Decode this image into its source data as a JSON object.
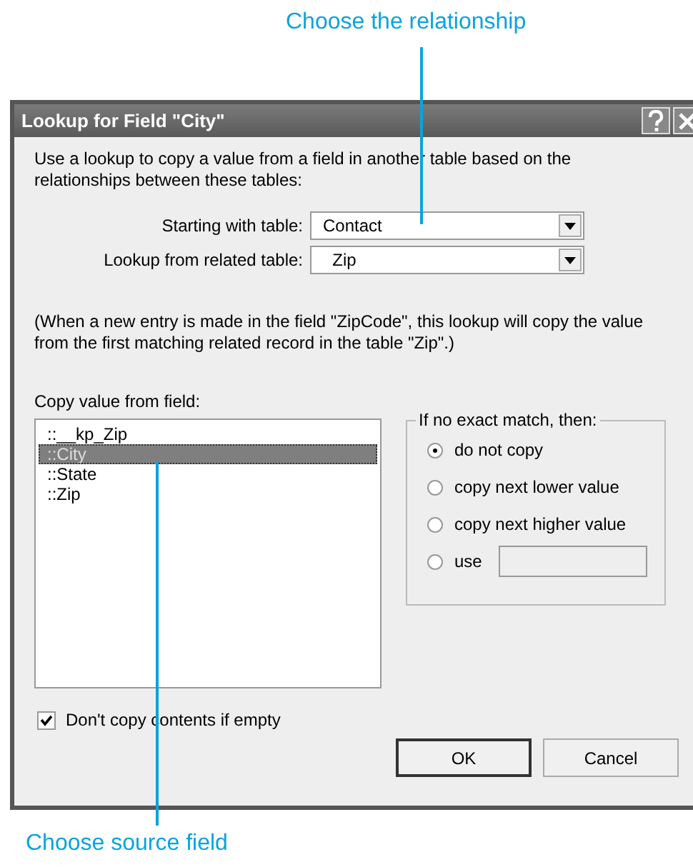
{
  "callouts": [
    {
      "text": "Choose the relationship"
    },
    {
      "text": "Choose source field"
    }
  ],
  "window": {
    "title": "Lookup for Field \"City\""
  },
  "intro": "Use a lookup to copy a value from a field in another table based on the relationships between these tables:",
  "selects": [
    {
      "label": "Starting with table:",
      "value": "Contact"
    },
    {
      "label": "Lookup from related table:",
      "value": "  Zip"
    }
  ],
  "note": "(When a new entry is made in the field \"ZipCode\", this lookup will copy the value from the first matching related record in the table \"Zip\".)",
  "copy_label": "Copy value from field:",
  "fields": [
    {
      "label": "::__kp_Zip",
      "selected": false
    },
    {
      "label": "::City",
      "selected": true
    },
    {
      "label": "::State",
      "selected": false
    },
    {
      "label": "::Zip",
      "selected": false
    }
  ],
  "group": {
    "title": "If no exact match, then:",
    "options": [
      {
        "label": "do not copy",
        "selected": true,
        "kind": "radio"
      },
      {
        "label": "copy next lower value",
        "selected": false,
        "kind": "radio"
      },
      {
        "label": "copy next higher value",
        "selected": false,
        "kind": "radio"
      },
      {
        "label": "use",
        "selected": false,
        "kind": "radio_field"
      }
    ]
  },
  "checkbox": {
    "label": "Don't copy contents if empty",
    "checked": true
  },
  "buttons": [
    {
      "label": "OK",
      "default": true
    },
    {
      "label": "Cancel",
      "default": false
    }
  ]
}
